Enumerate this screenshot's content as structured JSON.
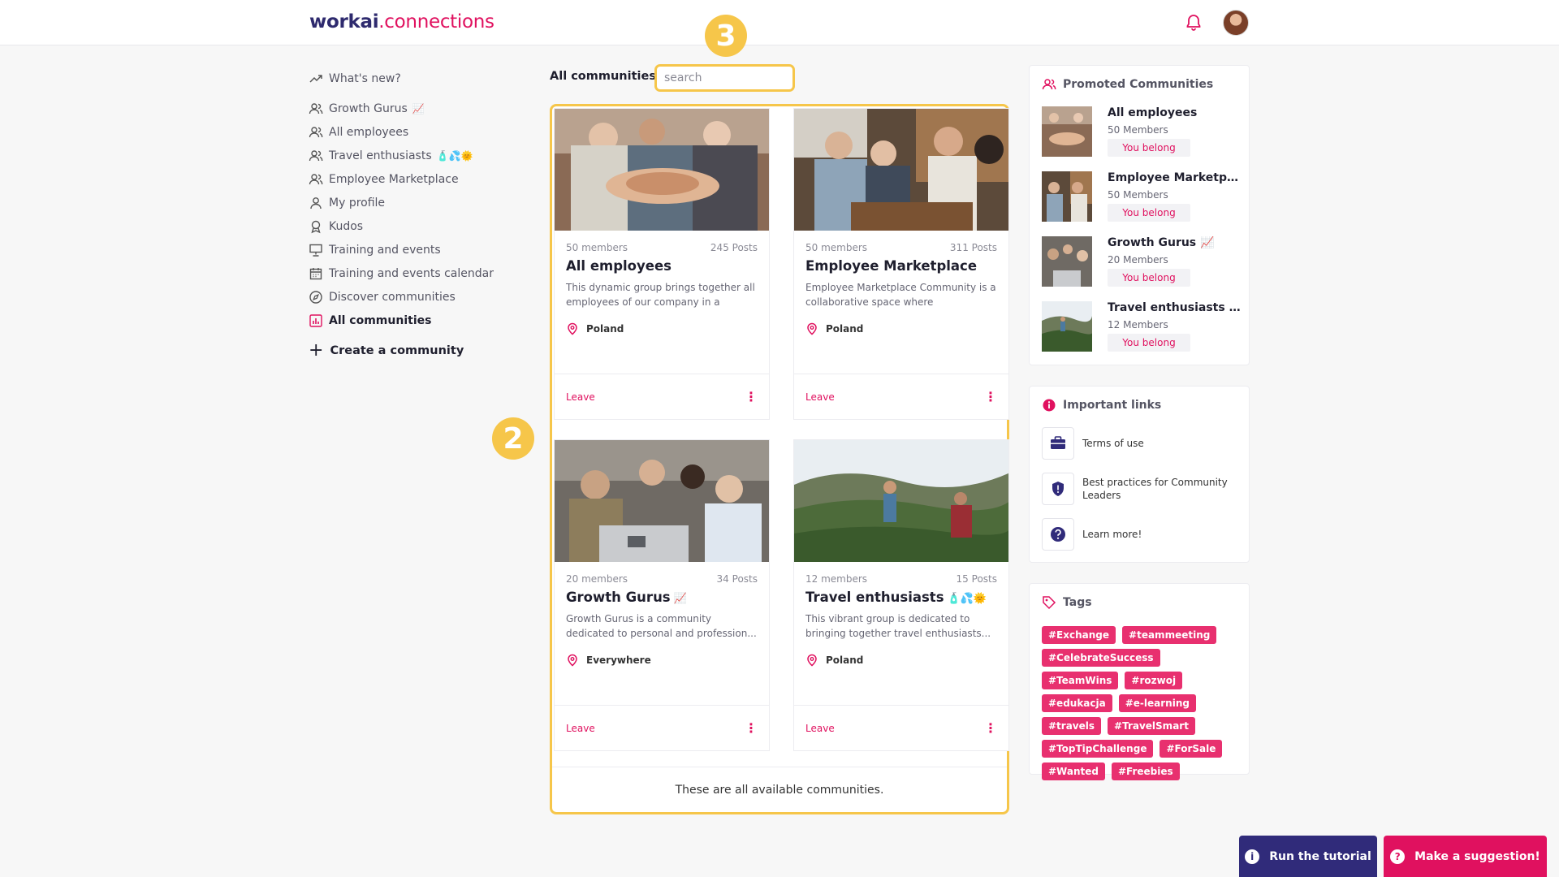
{
  "header": {
    "brand": "workai",
    "brand_suffix": ".connections"
  },
  "sidebar": {
    "items": [
      {
        "label": "What's new?",
        "emoji": ""
      },
      {
        "label": "Growth Gurus",
        "emoji": "📈"
      },
      {
        "label": "All employees",
        "emoji": ""
      },
      {
        "label": "Travel enthusiasts",
        "emoji": "🧴💦🌞"
      },
      {
        "label": "Employee Marketplace",
        "emoji": ""
      },
      {
        "label": "My profile",
        "emoji": ""
      },
      {
        "label": "Kudos",
        "emoji": ""
      },
      {
        "label": "Training and events",
        "emoji": ""
      },
      {
        "label": "Training and events calendar",
        "emoji": ""
      },
      {
        "label": "Discover communities",
        "emoji": ""
      },
      {
        "label": "All communities",
        "emoji": ""
      }
    ],
    "create_label": "Create a community"
  },
  "main": {
    "title": "All communities",
    "search_placeholder": "search",
    "step_badges": [
      "3",
      "2"
    ],
    "cards": [
      {
        "members": "50 members",
        "posts": "245 Posts",
        "title": "All employees",
        "emoji": "",
        "desc": "This dynamic group brings together all employees of our company in a virtua...",
        "location": "Poland",
        "leave": "Leave"
      },
      {
        "members": "50 members",
        "posts": "311 Posts",
        "title": "Employee Marketplace",
        "emoji": "",
        "desc": "Employee Marketplace Community is a collaborative space where employees...",
        "location": "Poland",
        "leave": "Leave"
      },
      {
        "members": "20 members",
        "posts": "34 Posts",
        "title": "Growth Gurus",
        "emoji": "📈",
        "desc": "Growth Gurus is a community dedicated to personal and profession...",
        "location": "Everywhere",
        "leave": "Leave"
      },
      {
        "members": "12 members",
        "posts": "15 Posts",
        "title": "Travel enthusiasts",
        "emoji": "🧴💦🌞",
        "desc": "This vibrant group is dedicated to bringing together travel enthusiasts...",
        "location": "Poland",
        "leave": "Leave"
      }
    ],
    "footer_text": "These are all available communities."
  },
  "promoted": {
    "title": "Promoted Communities",
    "items": [
      {
        "name": "All employees",
        "members": "50 Members",
        "status": "You belong"
      },
      {
        "name": "Employee Marketplace",
        "members": "50 Members",
        "status": "You belong"
      },
      {
        "name": "Growth Gurus 📈",
        "members": "20 Members",
        "status": "You belong"
      },
      {
        "name": "Travel enthusiasts 🧴💦🌞",
        "members": "12 Members",
        "status": "You belong"
      }
    ]
  },
  "links": {
    "title": "Important links",
    "items": [
      {
        "label": "Terms of use",
        "icon": "briefcase-icon"
      },
      {
        "label": "Best practices for Community Leaders",
        "icon": "shield-icon"
      },
      {
        "label": "Learn more!",
        "icon": "question-icon"
      }
    ]
  },
  "tags": {
    "title": "Tags",
    "items": [
      "#Exchange",
      "#teammeeting",
      "#CelebrateSuccess",
      "#TeamWins",
      "#rozwoj",
      "#edukacja",
      "#e-learning",
      "#travels",
      "#TravelSmart",
      "#TopTipChallenge",
      "#ForSale",
      "#Wanted",
      "#Freebies"
    ]
  },
  "buttons": {
    "tutorial": "Run the tutorial",
    "suggestion": "Make a suggestion!"
  },
  "colors": {
    "accent": "#e0115f",
    "brand": "#2e2a6e",
    "highlight": "#f6c64a",
    "tutorial_bg": "#302b7a"
  }
}
